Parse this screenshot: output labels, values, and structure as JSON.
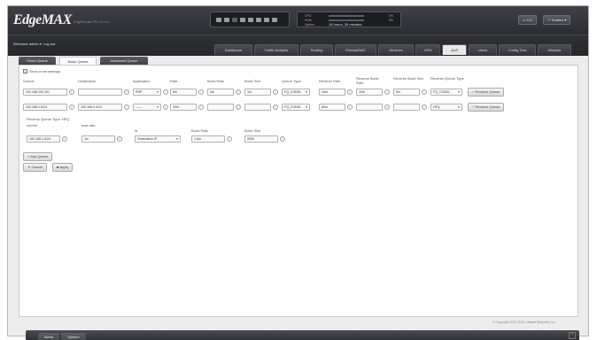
{
  "header": {
    "logo": "EdgeMAX",
    "logo_sub": "EdgeRouter Pro v1.9.0",
    "status": {
      "rows": [
        {
          "label": "CPU",
          "value": "0%"
        },
        {
          "label": "RAM",
          "value": "8%"
        },
        {
          "label": "Uptime",
          "value": "18 hours, 26 minutes"
        }
      ]
    },
    "cli_label": "CLI",
    "toolbox_label": "Toolbox"
  },
  "nav": {
    "welcome": "Welcome admin",
    "logout": "Log out",
    "tabs": [
      "Dashboard",
      "Traffic Analysis",
      "Routing",
      "Firewall/NAT",
      "Services",
      "VPN",
      "QoS",
      "Users",
      "Config Tree",
      "Wizards"
    ],
    "active_tab": "QoS"
  },
  "subtabs": [
    "Smart Queue",
    "Basic Queue",
    "Advanced Queue"
  ],
  "active_subtab": "Basic Queue",
  "basic_queue": {
    "show_burst_label": "Show burst settings",
    "show_burst_checked": true,
    "columns": [
      "Source",
      "Destination",
      "Application",
      "Rate",
      "Burst Rate",
      "Burst Size",
      "Queue Type",
      "Reverse Rate",
      "Reverse Burst Rate",
      "Reverse Burst Size",
      "Reverse Queue Type"
    ],
    "rows": [
      {
        "source": "192.168.100.101",
        "destination": "",
        "application": "RSP",
        "rate": "5m",
        "burst_rate": "2m",
        "burst_size": "1m",
        "queue_type": "FQ_CODEL",
        "reverse_rate": "10m",
        "reverse_burst_rate": "10m",
        "reverse_burst_size": "5m",
        "reverse_queue_type": "FQ_CODEL",
        "remove_label": "Remove Queue"
      },
      {
        "source": "192.168.1.0/24",
        "destination": "192.168.0.0/24",
        "application": "------",
        "rate": "30m",
        "burst_rate": "",
        "burst_size": "",
        "queue_type": "FQ_CODEL",
        "reverse_rate": "80m",
        "reverse_burst_rate": "",
        "reverse_burst_size": "",
        "reverse_queue_type": "HFQ",
        "remove_label": "Remove Queue"
      }
    ],
    "hfq": {
      "title": "Reverse Queue Type: HFQ",
      "columns": [
        "subnet",
        "max rate",
        "id",
        "Burst Rate",
        "Burst Size"
      ],
      "subnet": "192.168.1.0/24",
      "max_rate": "1m",
      "id": "Destination IP",
      "burst_rate": "1.6m",
      "burst_size": "500k"
    },
    "add_label": "Add Queue",
    "cancel_label": "Cancel",
    "apply_label": "Apply"
  },
  "footer": {
    "copyright": "© Copyright 2012-2016 Ubiquiti Networks, Inc.",
    "tabs": [
      "Alerts",
      "System"
    ]
  }
}
